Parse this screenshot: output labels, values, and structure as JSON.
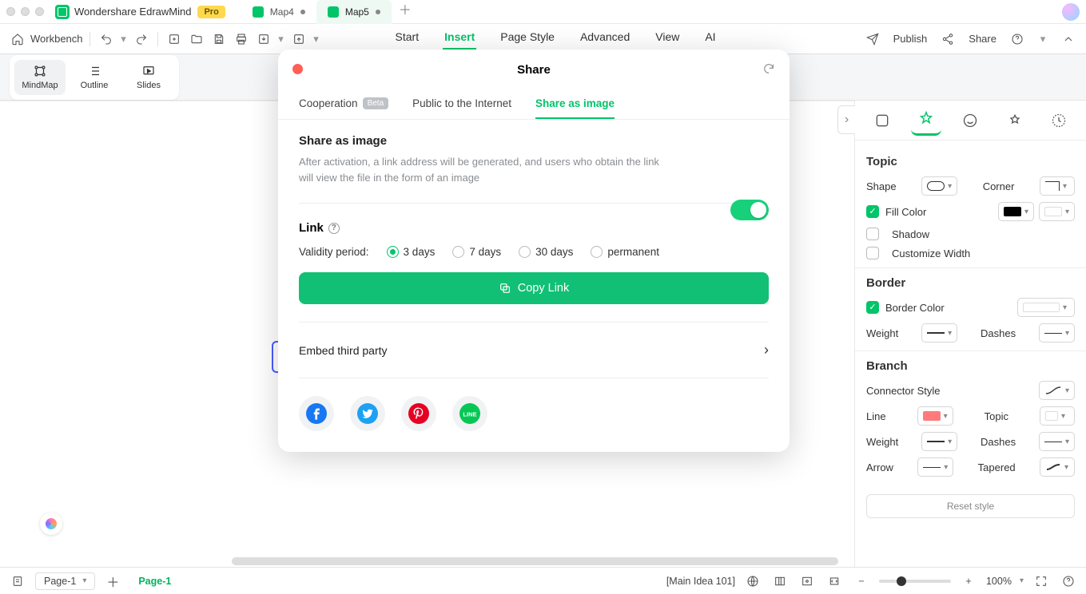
{
  "titlebar": {
    "app_name": "Wondershare EdrawMind",
    "pro_label": "Pro",
    "doc_tabs": [
      {
        "label": "Map4",
        "active": false
      },
      {
        "label": "Map5",
        "active": true
      }
    ]
  },
  "toolbar": {
    "workbench": "Workbench",
    "menu": {
      "start": "Start",
      "insert": "Insert",
      "page_style": "Page Style",
      "advanced": "Advanced",
      "view": "View",
      "ai": "AI"
    },
    "publish": "Publish",
    "share": "Share"
  },
  "viewstrip": {
    "mindmap": "MindMap",
    "outline": "Outline",
    "slides": "Slides"
  },
  "share_modal": {
    "title": "Share",
    "tabs": {
      "cooperation": "Cooperation",
      "beta": "Beta",
      "public": "Public to the Internet",
      "image": "Share as image"
    },
    "section_title": "Share as image",
    "section_desc": "After activation, a link address will be generated, and users who obtain the link will view the file in the form of an image",
    "toggle_on": true,
    "link_title": "Link",
    "validity_label": "Validity period:",
    "validity_options": {
      "d3": "3 days",
      "d7": "7 days",
      "d30": "30 days",
      "permanent": "permanent"
    },
    "validity_selected": "d3",
    "copy_link": "Copy Link",
    "embed": "Embed third party",
    "socials": {
      "facebook": "facebook-icon",
      "twitter": "twitter-icon",
      "pinterest": "pinterest-icon",
      "line": "line-icon"
    }
  },
  "rightpanel": {
    "topic_title": "Topic",
    "shape": "Shape",
    "corner": "Corner",
    "fill_color": "Fill Color",
    "shadow": "Shadow",
    "customize_width": "Customize Width",
    "border_title": "Border",
    "border_color": "Border Color",
    "weight": "Weight",
    "dashes": "Dashes",
    "branch_title": "Branch",
    "connector_style": "Connector Style",
    "line": "Line",
    "topic": "Topic",
    "arrow": "Arrow",
    "tapered": "Tapered",
    "reset": "Reset style",
    "colors": {
      "fill": "#000000",
      "line": "#ff7a7a",
      "border": "#ffffff",
      "topic": "#ffffff"
    }
  },
  "statusbar": {
    "page_selector": "Page-1",
    "page_tab": "Page-1",
    "node_status": "[Main Idea 101]",
    "zoom": "100%"
  }
}
